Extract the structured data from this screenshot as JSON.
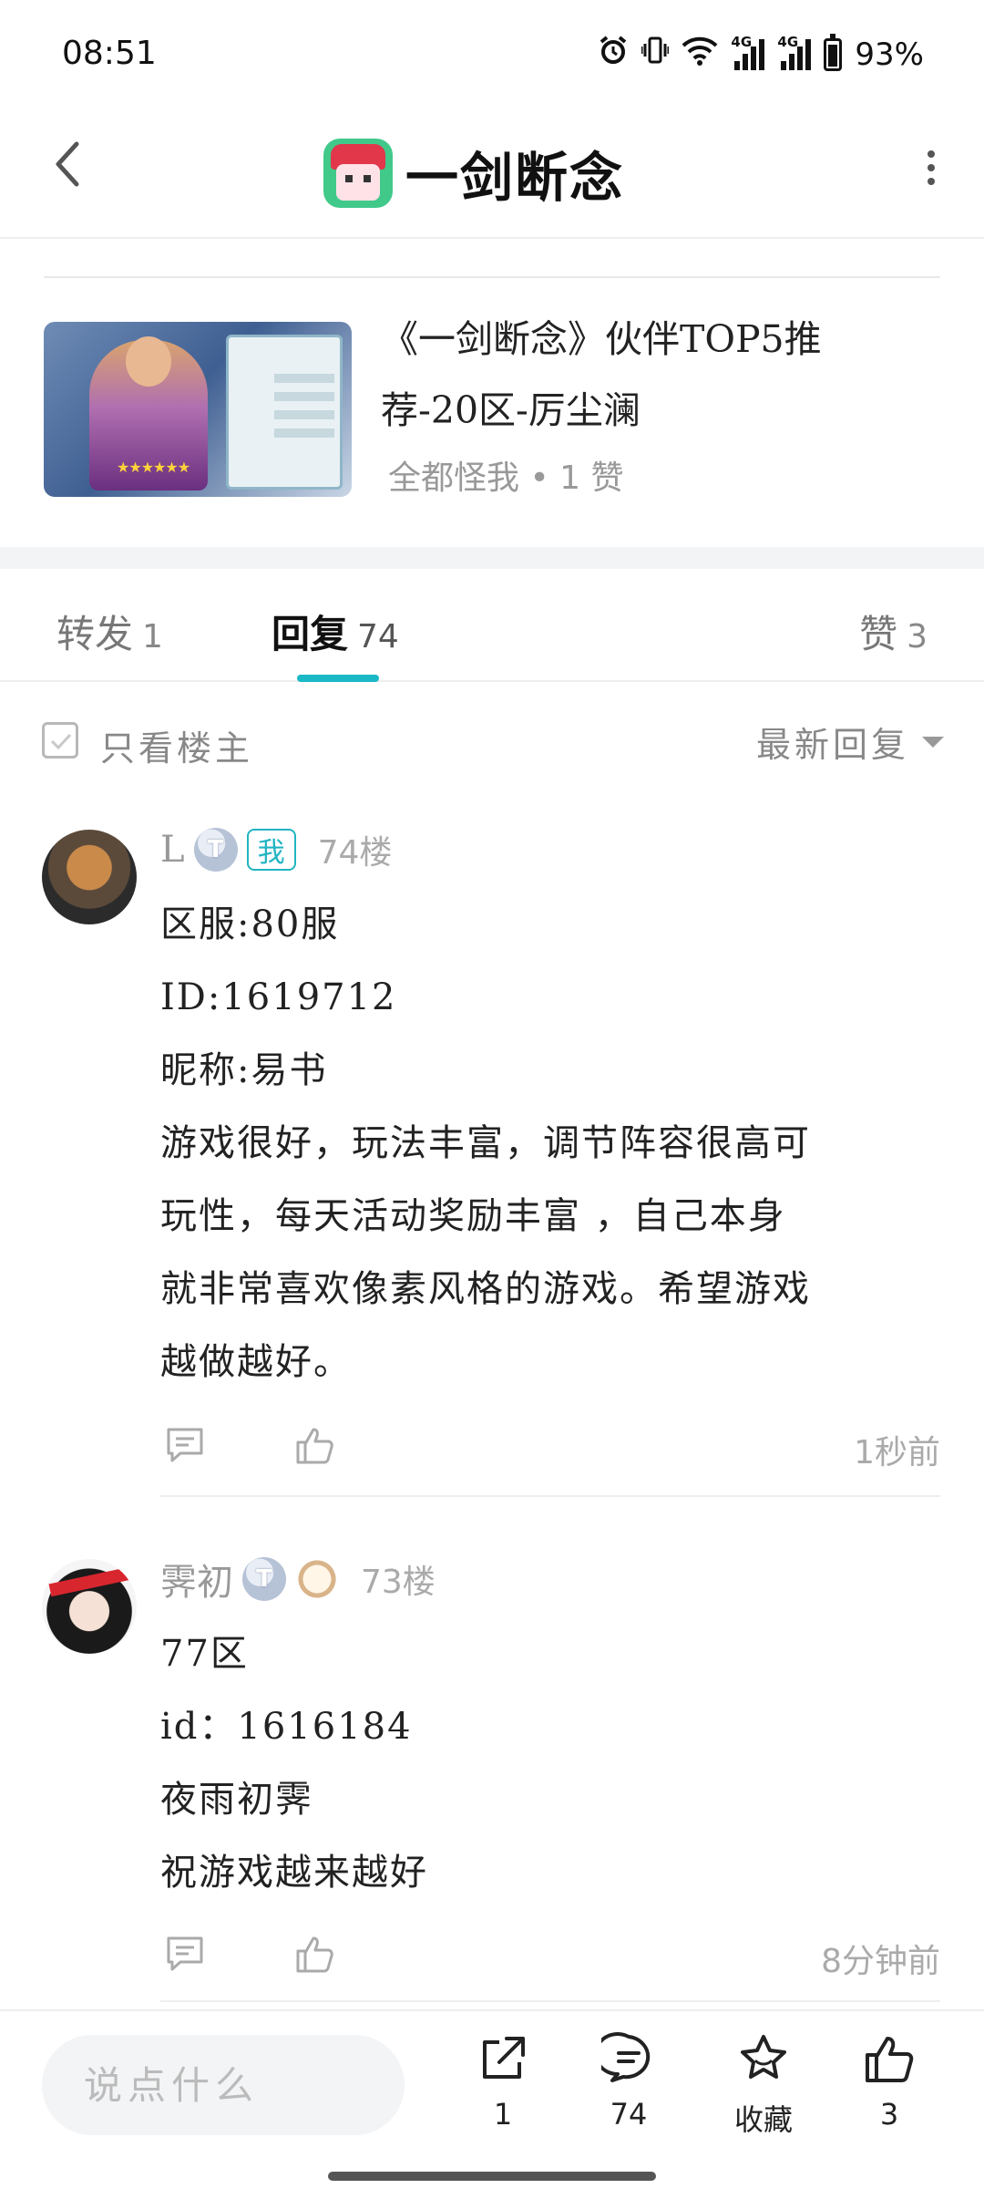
{
  "status_bar": {
    "time": "08:51",
    "battery": "93%",
    "net1": "4G",
    "net2": "4G"
  },
  "header": {
    "title": "一剑断念",
    "back_icon": "chevron-left-icon",
    "more_icon": "more-vertical-icon"
  },
  "article": {
    "title": "《一剑断念》伙伴TOP5推荐-20区-厉尘澜",
    "meta": "全都怪我 • 1 赞"
  },
  "tabs": [
    {
      "label": "转发",
      "count": "1"
    },
    {
      "label": "回复",
      "count": "74"
    },
    {
      "label": "赞",
      "count": "3"
    }
  ],
  "filter": {
    "only_op_label": "只看楼主",
    "sort_label": "最新回复"
  },
  "comments": [
    {
      "username": "L",
      "level": "T",
      "me_badge": "我",
      "floor": "74楼",
      "lines": [
        "区服:80服",
        "ID:1619712",
        "昵称:易书",
        "游戏很好，玩法丰富，调节阵容很高可\n玩性，每天活动奖励丰富 ，自己本身\n就非常喜欢像素风格的游戏。希望游戏\n越做越好。"
      ],
      "time": "1秒前"
    },
    {
      "username": "霁初",
      "level": "T",
      "floor": "73楼",
      "lines": [
        "77区",
        "id：1616184",
        "夜雨初霁",
        "祝游戏越来越好"
      ],
      "time": "8分钟前"
    }
  ],
  "bottom_bar": {
    "input_placeholder": "说点什么",
    "share_count": "1",
    "comment_count": "74",
    "favorite_label": "收藏",
    "like_count": "3"
  },
  "colors": {
    "accent": "#1bb8c6",
    "muted": "#999999"
  }
}
